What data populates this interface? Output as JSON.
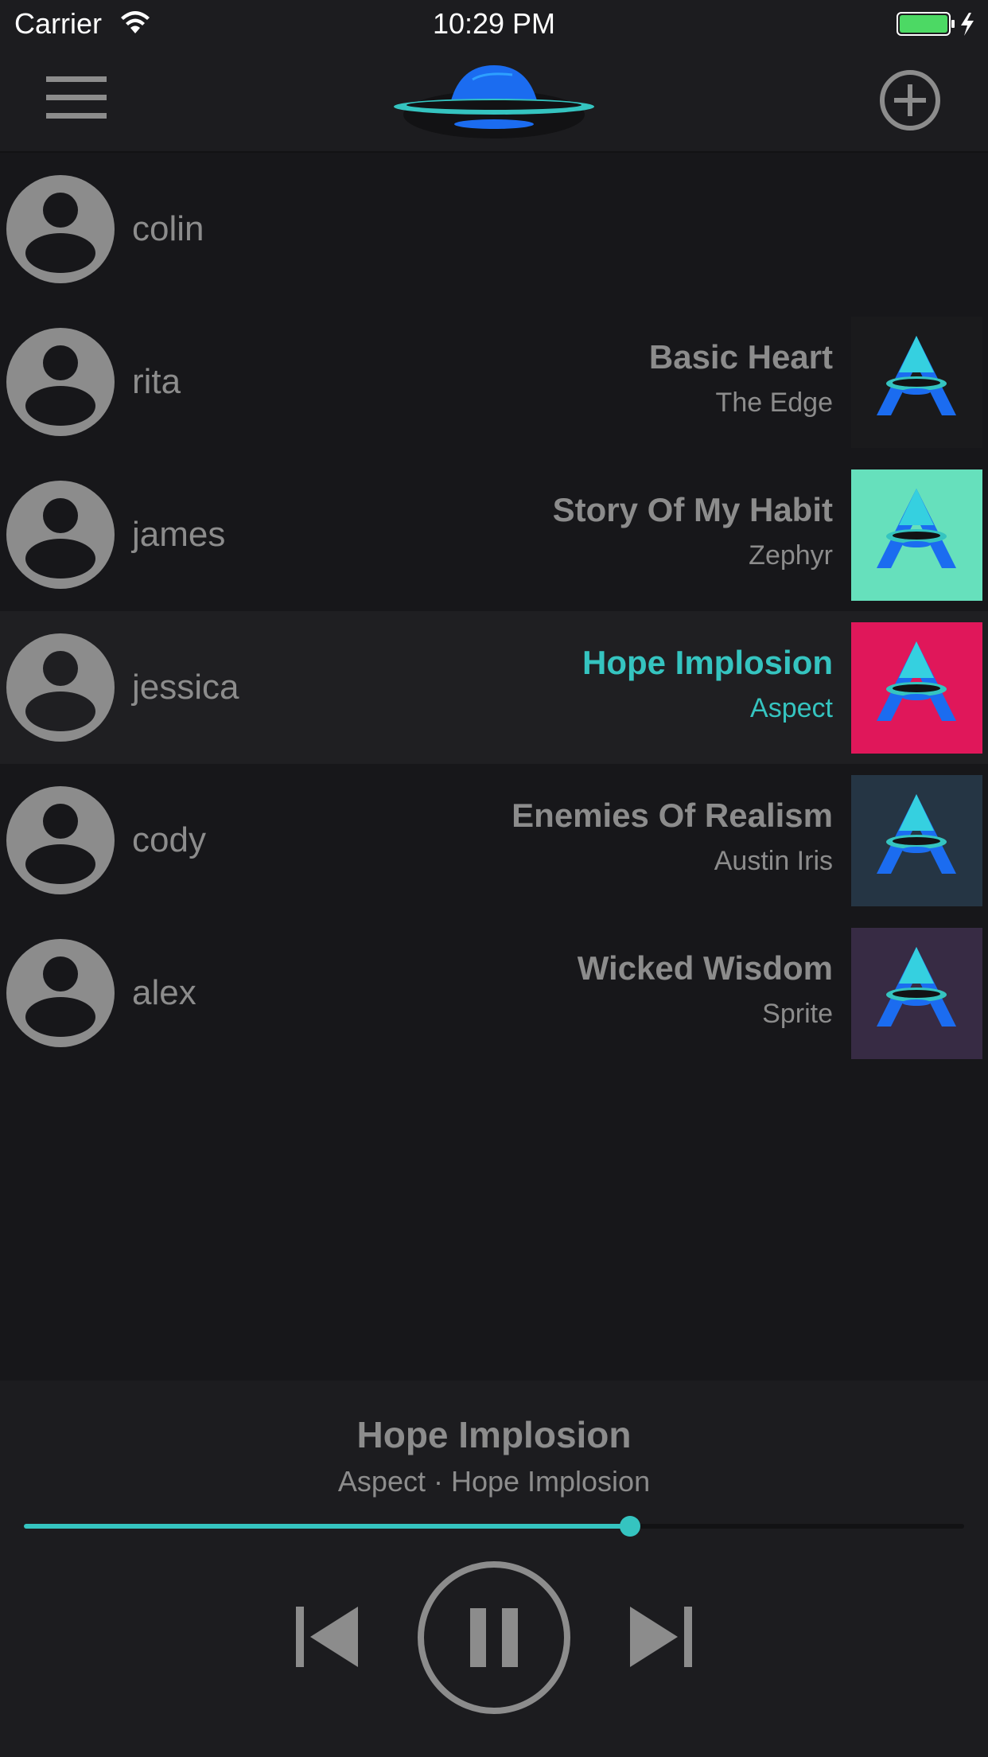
{
  "status_bar": {
    "carrier": "Carrier",
    "time": "10:29 PM",
    "icons": [
      "wifi-icon",
      "battery-icon",
      "charging-bolt-icon"
    ]
  },
  "nav_bar": {
    "left_icon": "hamburger-menu-icon",
    "center_icon": "ufo-logo-icon",
    "right_icon": "add-circle-icon"
  },
  "colors": {
    "background": "#17171a",
    "bar": "#1c1c1f",
    "accent": "#35c4c0",
    "text": "#8c8c8c"
  },
  "users": [
    {
      "name": "colin",
      "song": "",
      "artist": "",
      "art_color": null,
      "active": false
    },
    {
      "name": "rita",
      "song": "Basic Heart",
      "artist": "The Edge",
      "art_color": "#1a1a1c",
      "active": false
    },
    {
      "name": "james",
      "song": "Story Of My Habit",
      "artist": "Zephyr",
      "art_color": "#66e0bc",
      "active": false
    },
    {
      "name": "jessica",
      "song": "Hope Implosion",
      "artist": "Aspect",
      "art_color": "#e0175a",
      "active": true
    },
    {
      "name": "cody",
      "song": "Enemies Of Realism",
      "artist": "Austin Iris",
      "art_color": "#253544",
      "active": false
    },
    {
      "name": "alex",
      "song": "Wicked Wisdom",
      "artist": "Sprite",
      "art_color": "#372b44",
      "active": false
    }
  ],
  "player": {
    "title": "Hope Implosion",
    "subtitle": "Aspect · Hope Implosion",
    "progress": 0.645,
    "controls": [
      "skip-previous-icon",
      "pause-icon",
      "skip-next-icon"
    ]
  }
}
